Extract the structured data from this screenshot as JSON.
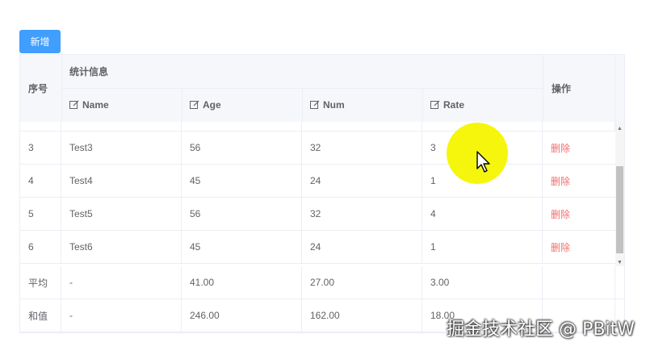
{
  "toolbar": {
    "add_label": "新增"
  },
  "table": {
    "headers": {
      "index": "序号",
      "group": "统计信息",
      "name": "Name",
      "age": "Age",
      "num": "Num",
      "rate": "Rate",
      "actions": "操作"
    },
    "rows": [
      {
        "index": "3",
        "name": "Test3",
        "age": "56",
        "num": "32",
        "rate": "3",
        "action": "删除"
      },
      {
        "index": "4",
        "name": "Test4",
        "age": "45",
        "num": "24",
        "rate": "1",
        "action": "删除"
      },
      {
        "index": "5",
        "name": "Test5",
        "age": "56",
        "num": "32",
        "rate": "4",
        "action": "删除"
      },
      {
        "index": "6",
        "name": "Test6",
        "age": "45",
        "num": "24",
        "rate": "1",
        "action": "删除"
      }
    ],
    "summary": [
      {
        "label": "平均",
        "name": "-",
        "age": "41.00",
        "num": "27.00",
        "rate": "3.00"
      },
      {
        "label": "和值",
        "name": "-",
        "age": "246.00",
        "num": "162.00",
        "rate": "18.00"
      }
    ]
  },
  "watermark": "掘金技术社区 @ PBitW",
  "colors": {
    "primary": "#409eff",
    "danger": "#f56c6c",
    "header_bg": "#f5f7fa",
    "border": "#ebeef5",
    "cursor_highlight": "#f5f500"
  },
  "icons": [
    "edit-icon",
    "scroll-up-arrow-icon",
    "scroll-down-arrow-icon",
    "mouse-pointer-icon"
  ]
}
